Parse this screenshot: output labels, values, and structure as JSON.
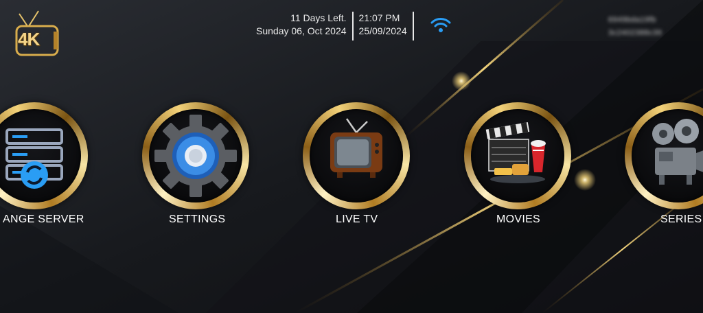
{
  "header": {
    "days_left": "11 Days Left.",
    "expiry_date": "Sunday 06, Oct 2024",
    "time": "21:07 PM",
    "date": "25/09/2024",
    "device_id_line1": "6949bda19fb",
    "device_id_line2": "3c2402388c39",
    "logo_text": "4K"
  },
  "menu": [
    {
      "label": "ANGE SERVER",
      "icon": "server-refresh-icon"
    },
    {
      "label": "SETTINGS",
      "icon": "gear-icon"
    },
    {
      "label": "LIVE TV",
      "icon": "tv-icon"
    },
    {
      "label": "MOVIES",
      "icon": "clapperboard-popcorn-icon"
    },
    {
      "label": "SERIES",
      "icon": "film-projector-icon"
    }
  ],
  "colors": {
    "gold": "#e2b857",
    "background": "#1b1d22",
    "wifi_blue": "#2a9df4"
  }
}
